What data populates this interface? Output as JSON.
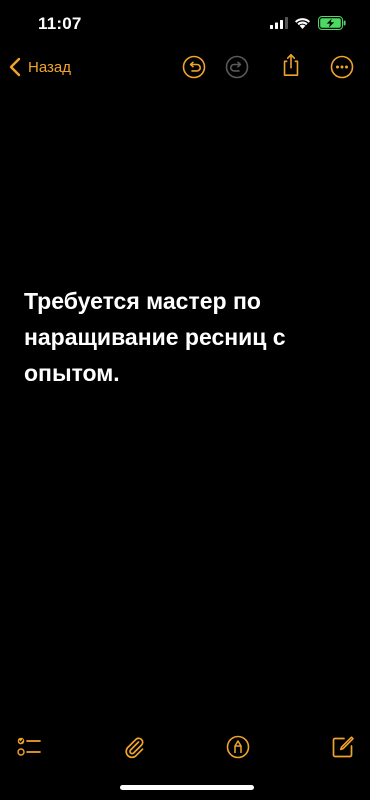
{
  "status_bar": {
    "time": "11:07",
    "icons": [
      "signal-icon",
      "wifi-icon",
      "battery-charging-icon"
    ]
  },
  "nav": {
    "back_label": "Назад",
    "icons": [
      "undo-icon",
      "redo-icon",
      "share-icon",
      "more-icon"
    ]
  },
  "note": {
    "text": "Требуется мастер по\nнаращивание ресниц с\nопытом."
  },
  "toolbar": {
    "icons": [
      "checklist-icon",
      "attachment-icon",
      "markup-icon",
      "compose-icon"
    ]
  },
  "colors": {
    "background": "#000000",
    "accent": "#f0a52a",
    "battery": "#4cd964",
    "text": "#ffffff"
  }
}
